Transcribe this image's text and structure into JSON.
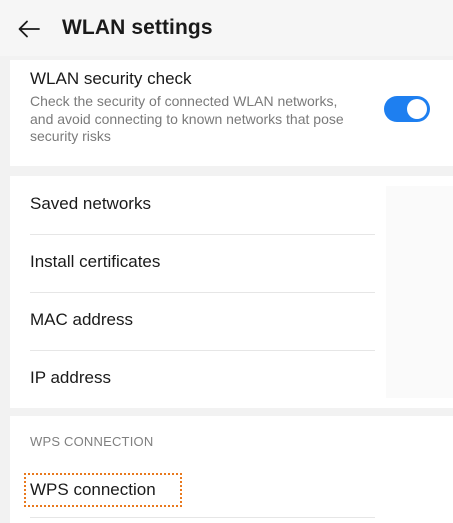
{
  "header": {
    "title": "WLAN settings",
    "back_icon": "arrow-left-icon"
  },
  "security_check": {
    "title": "WLAN security check",
    "description": "Check the security of connected WLAN networks, and avoid connecting to known networks that pose security risks",
    "toggle_on": true,
    "toggle_color": "#1e7ff0"
  },
  "settings_list": {
    "items": [
      {
        "label": "Saved networks"
      },
      {
        "label": "Install certificates"
      },
      {
        "label": "MAC address"
      },
      {
        "label": "IP address"
      }
    ]
  },
  "wps_section": {
    "header": "WPS CONNECTION",
    "item_label": "WPS connection",
    "highlight_color": "#e8791e"
  }
}
